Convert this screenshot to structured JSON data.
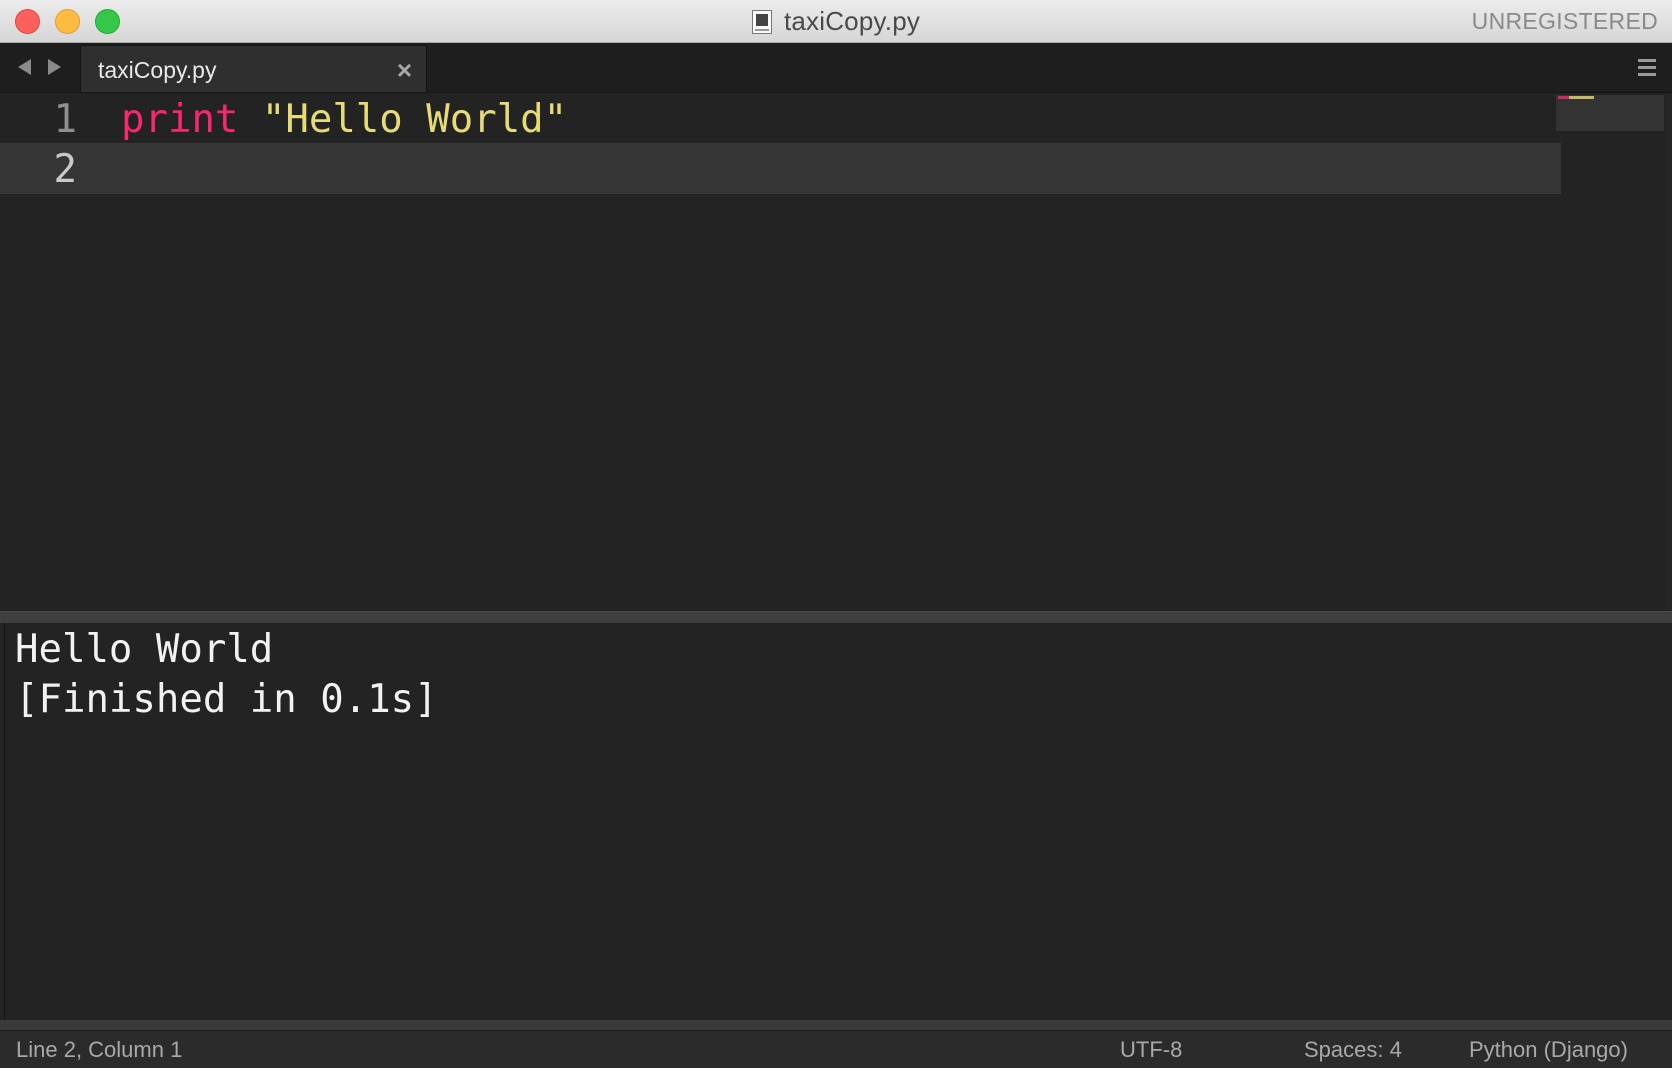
{
  "window": {
    "title": "taxiCopy.py",
    "unregistered_label": "UNREGISTERED"
  },
  "tabs": [
    {
      "label": "taxiCopy.py",
      "close_glyph": "×"
    }
  ],
  "editor": {
    "lines": [
      {
        "number": "1",
        "keyword": "print",
        "string": "\"Hello World\""
      },
      {
        "number": "2",
        "keyword": "",
        "string": ""
      }
    ],
    "colors": {
      "keyword": "#f92672",
      "string": "#e6db74",
      "background": "#232323"
    }
  },
  "output": {
    "lines": [
      "Hello World",
      "[Finished in 0.1s]"
    ]
  },
  "statusbar": {
    "position": "Line 2, Column 1",
    "encoding": "UTF-8",
    "indentation": "Spaces: 4",
    "syntax": "Python (Django)"
  }
}
